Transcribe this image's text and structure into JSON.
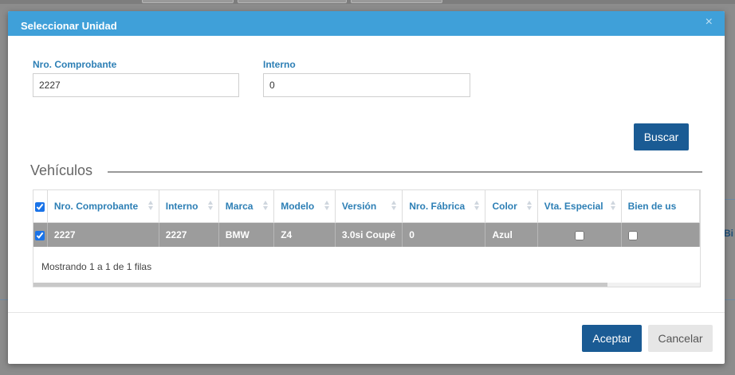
{
  "background": {
    "partial_text": "Bi"
  },
  "modal": {
    "title": "Seleccionar Unidad",
    "close_glyph": "×",
    "fields": {
      "comprobante": {
        "label": "Nro. Comprobante",
        "value": "2227"
      },
      "interno": {
        "label": "Interno",
        "value": "0"
      }
    },
    "search_label": "Buscar",
    "section_title": "Vehículos",
    "table": {
      "columns": [
        "Nro. Comprobante",
        "Interno",
        "Marca",
        "Modelo",
        "Versión",
        "Nro. Fábrica",
        "Color",
        "Vta. Especial",
        "Bien de us"
      ],
      "rows": [
        {
          "selected": true,
          "comprobante": "2227",
          "interno": "2227",
          "marca": "BMW",
          "modelo": "Z4",
          "version": "3.0si Coupé",
          "fabrica": "0",
          "color": "Azul",
          "vta_especial": false,
          "bien_de_uso": false
        }
      ],
      "footer": "Mostrando 1 a 1 de 1 filas"
    },
    "accept_label": "Aceptar",
    "cancel_label": "Cancelar"
  },
  "colors": {
    "header": "#3fa0d9",
    "primary": "#1a5b94",
    "label": "#2d7fb5",
    "selected_row": "#9c9c9c"
  }
}
